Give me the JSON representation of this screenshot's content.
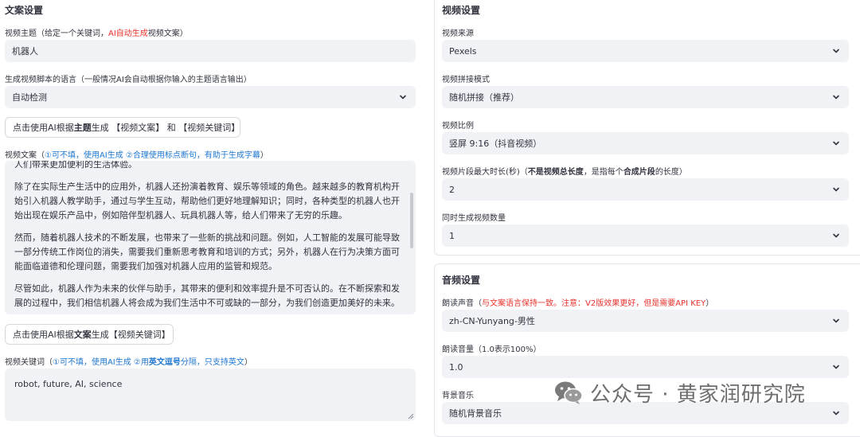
{
  "left": {
    "title": "文案设置",
    "subject_label": {
      "pre": "视频主题（给定一个关键词，",
      "red": "AI自动生成",
      "post": "视频文案）"
    },
    "subject_value": "机器人",
    "language_label": "生成视频脚本的语言（一般情况AI会自动根据你输入的主题语言输出）",
    "language_value": "自动检测",
    "btn1": {
      "pre": "点击使用AI根据",
      "bold": "主题",
      "post": "生成 【视频文案】 和 【视频关键词】"
    },
    "script_label": {
      "pre": "视频文案（",
      "blue": "①可不填，使用AI生成 ②合理使用标点断句，有助于生成字幕",
      "post": "）"
    },
    "script_paragraphs": [
      "人们带来更加便利的生活体验。",
      "除了在实际生产生活中的应用外，机器人还扮演着教育、娱乐等领域的角色。越来越多的教育机构开始引入机器人教学助手，通过与学生互动，帮助他们更好地理解知识；同时，各种类型的机器人也开始出现在娱乐产品中，例如陪伴型机器人、玩具机器人等，给人们带来了无穷的乐趣。",
      "然而，随着机器人技术的不断发展，也带来了一些新的挑战和问题。例如，人工智能的发展可能导致一部分传统工作岗位的消失，需要我们重新思考教育和培训的方式；另外，机器人在行为决策方面可能面临道德和伦理问题，需要我们加强对机器人应用的监管和规范。",
      "尽管如此，机器人作为未来的伙伴与助手，其带来的便利和效率提升是不可否认的。在不断探索和发展的过程中，我们相信机器人将会成为我们生活中不可或缺的一部分，为我们创造更加美好的未来。"
    ],
    "btn2": {
      "pre": "点击使用AI根据",
      "bold": "文案",
      "post": "生成【视频关键词】"
    },
    "keywords_label": {
      "pre": "视频关键词（",
      "blue1": "①可不填，使用AI生成 ②用",
      "bold": "英文逗号",
      "blue2": "分隔，只支持英文",
      "post": "）"
    },
    "keywords_value": "robot, future, AI, science"
  },
  "video": {
    "title": "视频设置",
    "source_label": "视频来源",
    "source_value": "Pexels",
    "concat_label": "视频拼接模式",
    "concat_value": "随机拼接（推荐）",
    "ratio_label": "视频比例",
    "ratio_value": "竖屏 9:16（抖音视频）",
    "clip_label": {
      "pre": "视频片段最大时长(秒)（",
      "b1": "不是视频总长度",
      "mid": "，是指每个",
      "b2": "合成片段",
      "post": "的长度）"
    },
    "clip_value": "2",
    "count_label": "同时生成视频数量",
    "count_value": "1"
  },
  "audio": {
    "title": "音频设置",
    "voice_label": {
      "pre": "朗读声音（",
      "red": "与文案语言保持一致。注意：V2版效果更好，但是需要API KEY",
      "post": "）"
    },
    "voice_value": "zh-CN-Yunyang-男性",
    "volume_label": "朗读音量（1.0表示100%）",
    "volume_value": "1.0",
    "bgm_label": "背景音乐",
    "bgm_value": "随机背景音乐"
  },
  "watermark": {
    "text": "公众号 · 黄家润研究院",
    "icon": "wechat-icon"
  },
  "colors": {
    "field_bg": "#f0f2f6",
    "red": "#e8322c",
    "blue": "#1f77d0",
    "text": "#31333f"
  }
}
